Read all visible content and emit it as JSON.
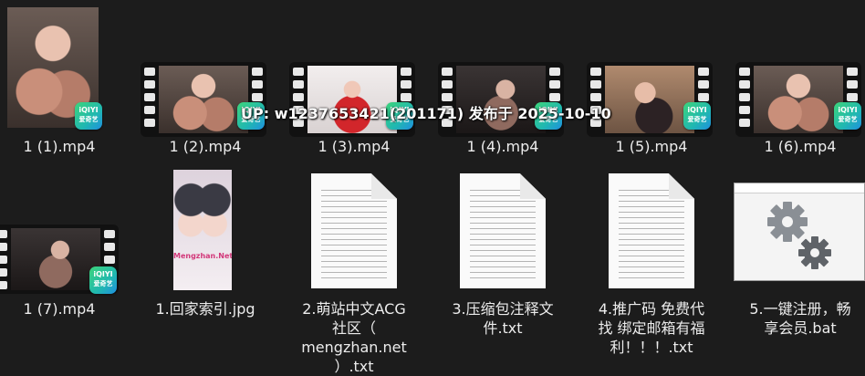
{
  "files": [
    {
      "name": "1 (1).mp4"
    },
    {
      "name": "1 (2).mp4"
    },
    {
      "name": "1 (3).mp4"
    },
    {
      "name": "1 (4).mp4"
    },
    {
      "name": "1 (5).mp4"
    },
    {
      "name": "1 (6).mp4"
    },
    {
      "name": "1 (7).mp4"
    },
    {
      "name": "1.回家索引.jpg"
    },
    {
      "name_lines": [
        "2.萌站中文ACG",
        "社区（",
        "mengzhan.net",
        "）.txt"
      ]
    },
    {
      "name_lines": [
        "3.压缩包注释文",
        "件.txt"
      ]
    },
    {
      "name_lines": [
        "4.推广码 免费代",
        "找 绑定邮箱有福",
        "利！！！.txt"
      ]
    },
    {
      "name_lines": [
        "5.一键注册，畅",
        "享会员.bat"
      ]
    }
  ],
  "badge": {
    "line1": "iQIYI",
    "line2": "爱奇艺"
  },
  "jpg_overlay_text": "Mengzhan.Net",
  "watermark": "UP: w1237653421(201171) 发布于 2025-10-10",
  "colors": {
    "background": "#1c1c1c",
    "text": "#ececec",
    "badge_start": "#3dd47b",
    "badge_end": "#1f8fe0"
  }
}
